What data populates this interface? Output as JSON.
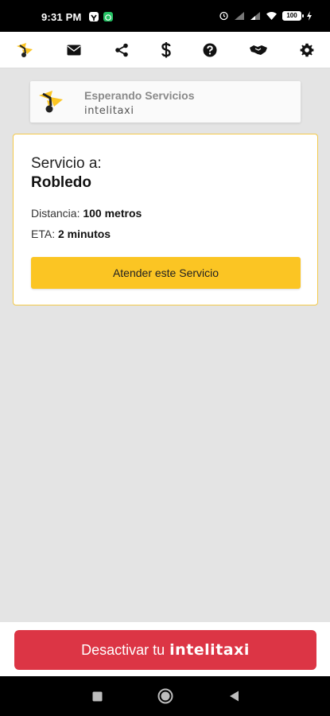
{
  "status_bar": {
    "time": "9:31 PM",
    "battery": "100"
  },
  "toolbar": {
    "items": [
      {
        "name": "logo-icon"
      },
      {
        "name": "mail-icon"
      },
      {
        "name": "share-icon"
      },
      {
        "name": "dollar-icon"
      },
      {
        "name": "help-icon"
      },
      {
        "name": "handshake-icon"
      },
      {
        "name": "gear-icon"
      }
    ]
  },
  "header": {
    "title": "Esperando Servicios",
    "brand": "intelitaxi"
  },
  "service": {
    "label": "Servicio a:",
    "destination": "Robledo",
    "distance_label": "Distancia:",
    "distance_value": "100 metros",
    "eta_label": "ETA:",
    "eta_value": "2 minutos",
    "attend_label": "Atender este Servicio"
  },
  "deactivate": {
    "text": "Desactivar tu",
    "brand": "intelitaxi"
  },
  "colors": {
    "accent_yellow": "#fbc523",
    "danger_red": "#dc3545",
    "card_border": "#f3c94a"
  }
}
